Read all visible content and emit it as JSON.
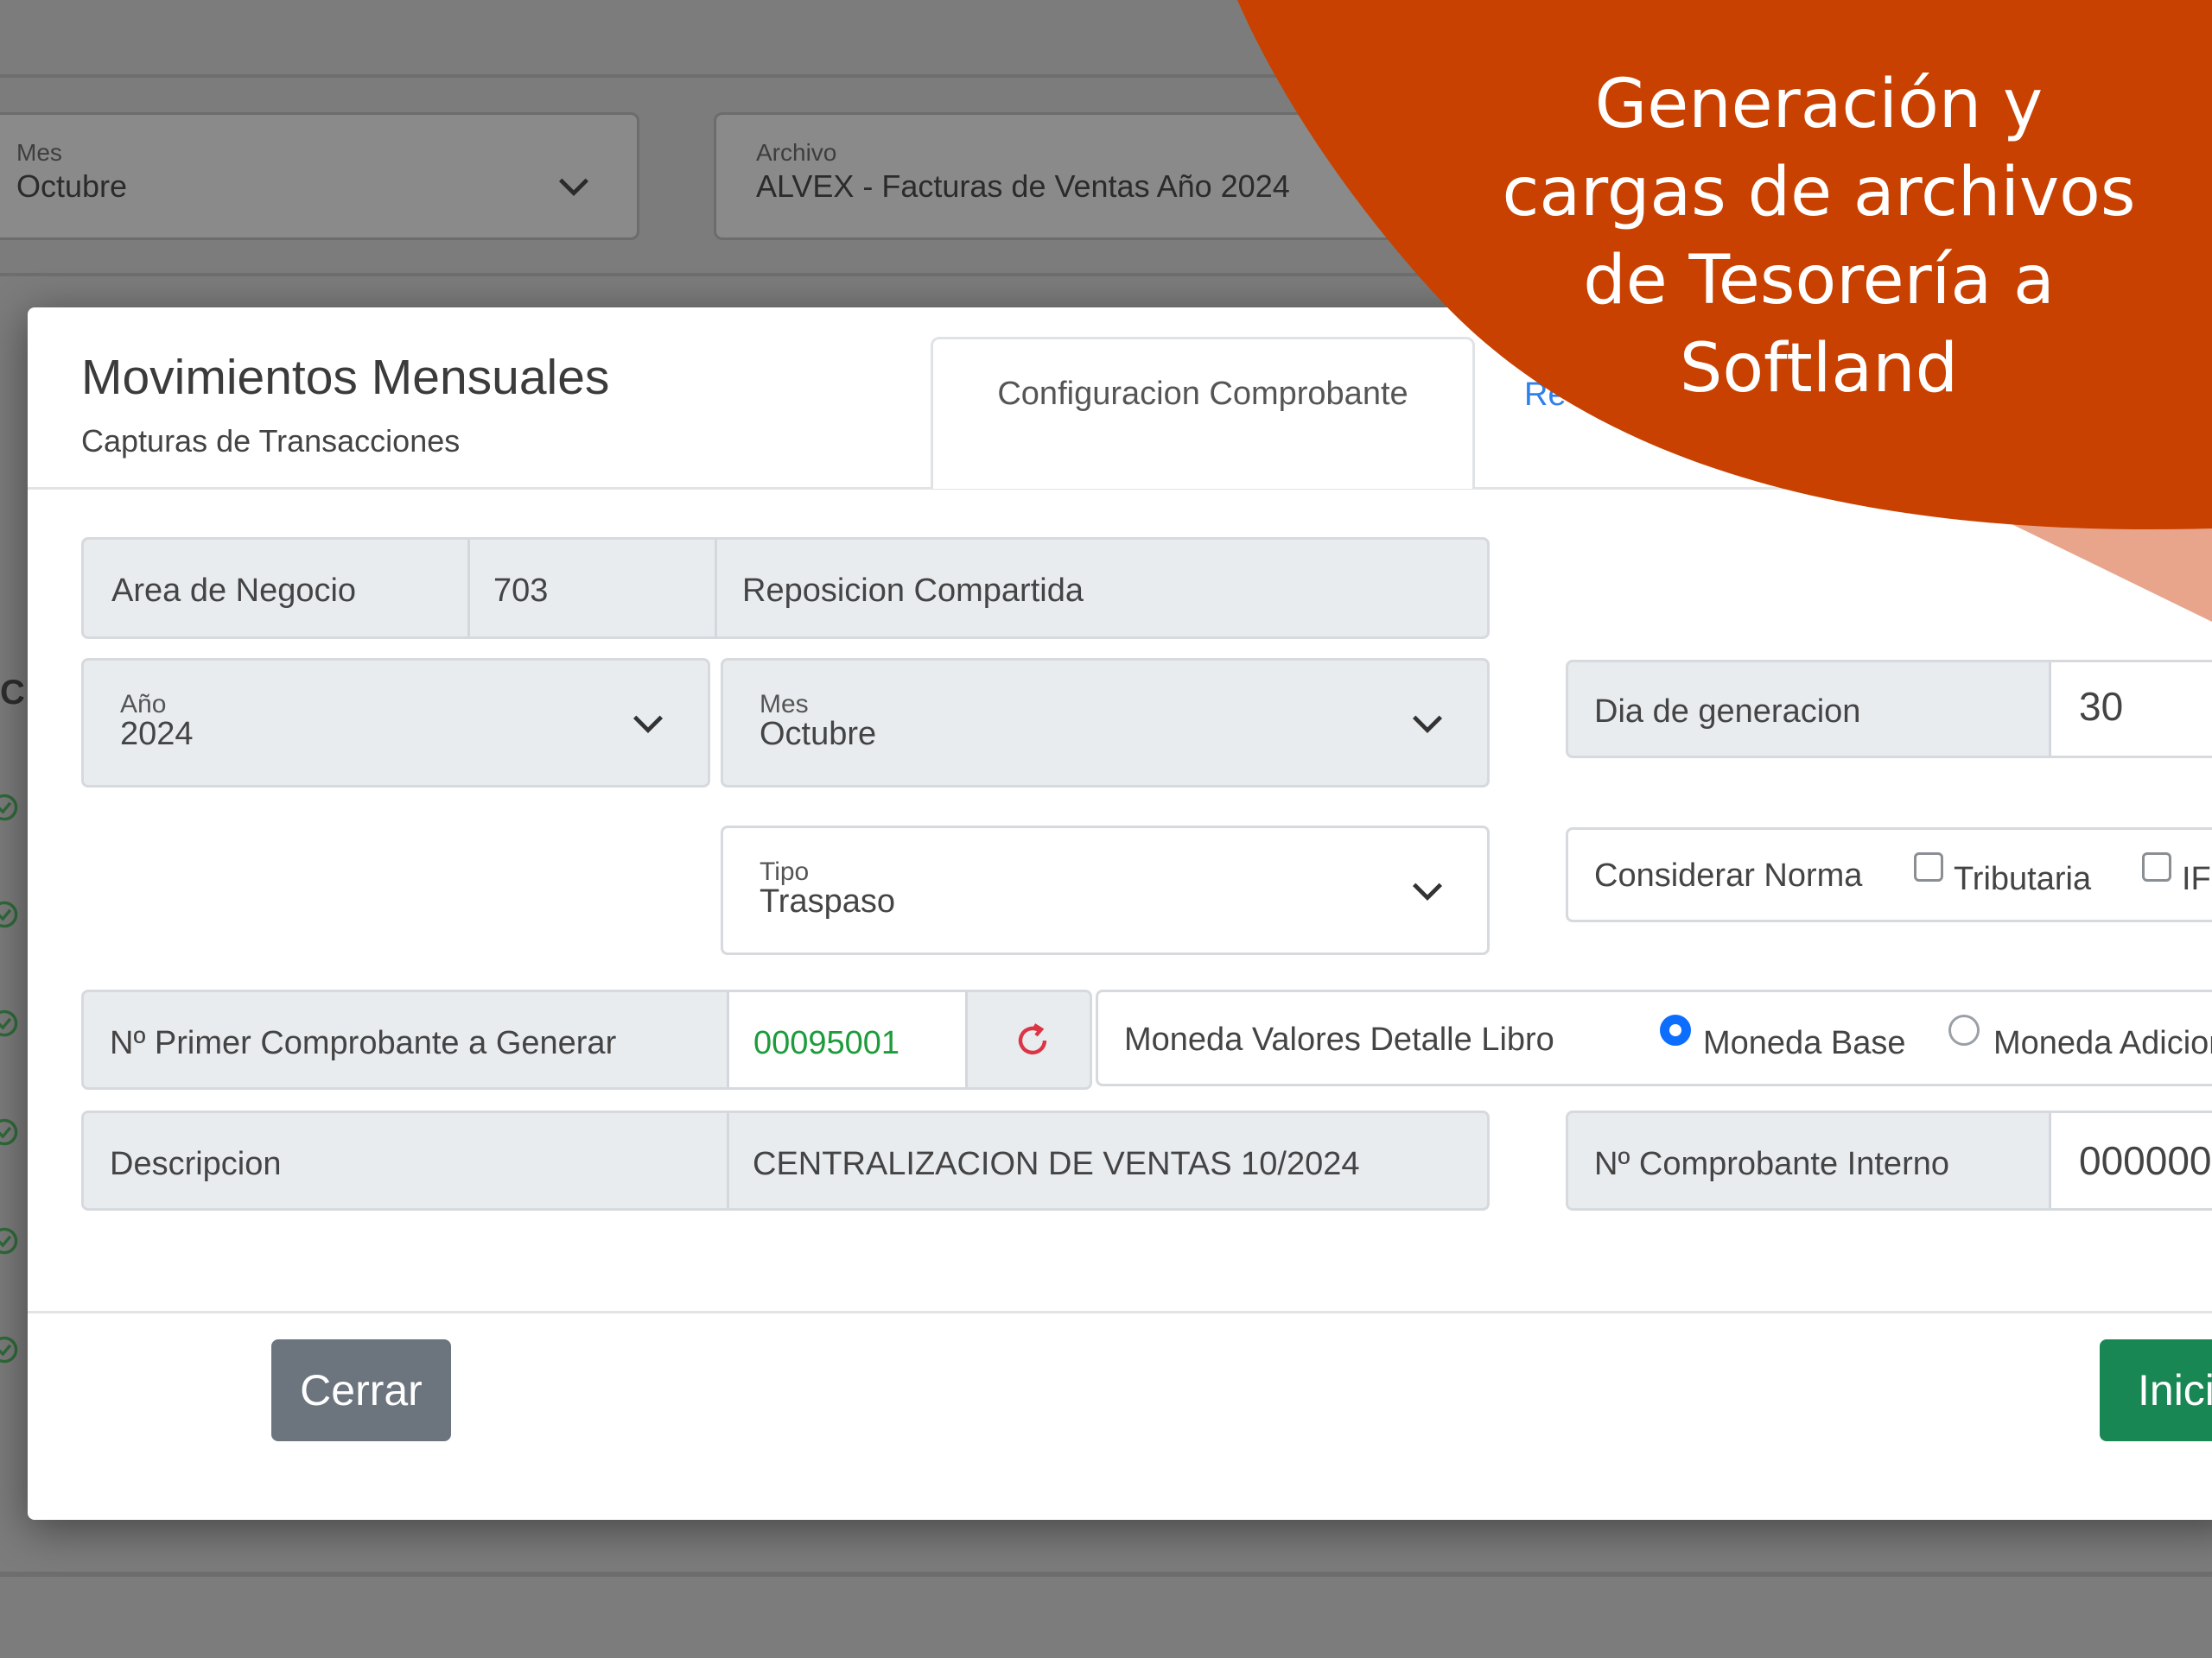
{
  "background": {
    "month_select": {
      "label": "Mes",
      "value": "Octubre"
    },
    "file_select": {
      "label": "Archivo",
      "value": "ALVEX - Facturas de Ventas Año 2024"
    }
  },
  "modal": {
    "title": "Movimientos Mensuales",
    "subtitle": "Capturas de Transacciones",
    "tabs": [
      {
        "label": "Configuracion Comprobante"
      },
      {
        "label": "Re"
      }
    ],
    "business_area": {
      "label": "Area de Negocio",
      "code": "703",
      "name": "Reposicion Compartida"
    },
    "year_select": {
      "label": "Año",
      "value": "2024"
    },
    "month_select": {
      "label": "Mes",
      "value": "Octubre"
    },
    "generation_day": {
      "label": "Dia de generacion",
      "value": "30"
    },
    "type_select": {
      "label": "Tipo",
      "value": "Traspaso"
    },
    "norm": {
      "label": "Considerar Norma",
      "options": [
        {
          "label": "Tributaria"
        },
        {
          "label": "IF"
        }
      ]
    },
    "first_voucher": {
      "label": "Nº Primer Comprobante a Generar",
      "value": "00095001"
    },
    "currency": {
      "label": "Moneda Valores Detalle Libro",
      "options": [
        {
          "label": "Moneda Base",
          "checked": true
        },
        {
          "label": "Moneda Adicion",
          "checked": false
        }
      ]
    },
    "description": {
      "label": "Descripcion",
      "value": "CENTRALIZACION DE VENTAS 10/2024"
    },
    "internal_voucher": {
      "label": "Nº Comprobante Interno",
      "value": "000000"
    },
    "close_button": "Cerrar",
    "start_button": "Inicia"
  },
  "banner": {
    "lines": [
      "Generación y",
      "cargas de archivos",
      "de Tesorería a",
      "Softland"
    ],
    "color": "#c94100",
    "accent_color": "#e8a58c"
  },
  "colors": {
    "primary": "#0d6efd",
    "success": "#198754",
    "secondary": "#6c757d",
    "valid_green": "#1e9b3c"
  }
}
